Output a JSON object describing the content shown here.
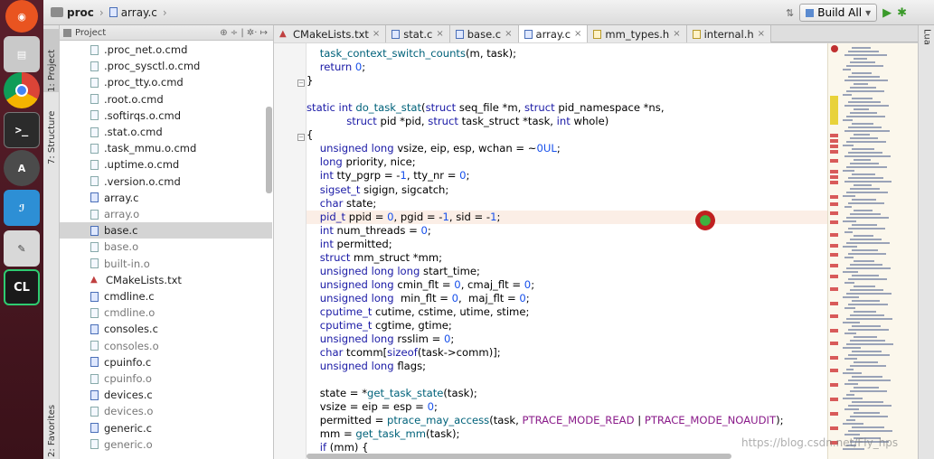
{
  "titlebar": {
    "crumb_folder": "proc",
    "crumb_file": "array.c",
    "build_config": "Build All",
    "build_arrow": "▾",
    "run_icon": "▶",
    "debug_icon": "✱",
    "swap_icon": "⇅"
  },
  "toolstrip": {
    "project": "1: Project",
    "structure": "7: Structure",
    "favorites": "2: Favorites",
    "lua": "Lua"
  },
  "project_panel": {
    "title": "Project",
    "tools": "⊕  ÷  |  ✲·  ↦",
    "items": [
      {
        "name": ".proc_net.o.cmd",
        "kind": "file",
        "dim": false
      },
      {
        "name": ".proc_sysctl.o.cmd",
        "kind": "file",
        "dim": false
      },
      {
        "name": ".proc_tty.o.cmd",
        "kind": "file",
        "dim": false
      },
      {
        "name": ".root.o.cmd",
        "kind": "file",
        "dim": false
      },
      {
        "name": ".softirqs.o.cmd",
        "kind": "file",
        "dim": false
      },
      {
        "name": ".stat.o.cmd",
        "kind": "file",
        "dim": false
      },
      {
        "name": ".task_mmu.o.cmd",
        "kind": "file",
        "dim": false
      },
      {
        "name": ".uptime.o.cmd",
        "kind": "file",
        "dim": false
      },
      {
        "name": ".version.o.cmd",
        "kind": "file",
        "dim": false
      },
      {
        "name": "array.c",
        "kind": "c",
        "dim": false
      },
      {
        "name": "array.o",
        "kind": "file",
        "dim": true
      },
      {
        "name": "base.c",
        "kind": "c",
        "dim": false
      },
      {
        "name": "base.o",
        "kind": "file",
        "dim": true
      },
      {
        "name": "built-in.o",
        "kind": "file",
        "dim": true
      },
      {
        "name": "CMakeLists.txt",
        "kind": "cmake",
        "dim": false
      },
      {
        "name": "cmdline.c",
        "kind": "c",
        "dim": false
      },
      {
        "name": "cmdline.o",
        "kind": "file",
        "dim": true
      },
      {
        "name": "consoles.c",
        "kind": "c",
        "dim": false
      },
      {
        "name": "consoles.o",
        "kind": "file",
        "dim": true
      },
      {
        "name": "cpuinfo.c",
        "kind": "c",
        "dim": false
      },
      {
        "name": "cpuinfo.o",
        "kind": "file",
        "dim": true
      },
      {
        "name": "devices.c",
        "kind": "c",
        "dim": false
      },
      {
        "name": "devices.o",
        "kind": "file",
        "dim": true
      },
      {
        "name": "generic.c",
        "kind": "c",
        "dim": false
      },
      {
        "name": "generic.o",
        "kind": "file",
        "dim": true
      }
    ]
  },
  "tabs": [
    {
      "label": "CMakeLists.txt",
      "kind": "cmake",
      "close": "×"
    },
    {
      "label": "stat.c",
      "kind": "c",
      "close": "×"
    },
    {
      "label": "base.c",
      "kind": "c",
      "close": "×"
    },
    {
      "label": "array.c",
      "kind": "c",
      "close": "×"
    },
    {
      "label": "mm_types.h",
      "kind": "h",
      "close": "×"
    },
    {
      "label": "internal.h",
      "kind": "h",
      "close": "×"
    }
  ],
  "code": [
    "    task_context_switch_counts(m, task);",
    "    return 0;",
    "}",
    "",
    "static int do_task_stat(struct seq_file *m, struct pid_namespace *ns,",
    "            struct pid *pid, struct task_struct *task, int whole)",
    "{",
    "    unsigned long vsize, eip, esp, wchan = ~0UL;",
    "    long priority, nice;",
    "    int tty_pgrp = -1, tty_nr = 0;",
    "    sigset_t sigign, sigcatch;",
    "    char state;",
    "    pid_t ppid = 0, pgid = -1, sid = -1;",
    "    int num_threads = 0;",
    "    int permitted;",
    "    struct mm_struct *mm;",
    "    unsigned long long start_time;",
    "    unsigned long cmin_flt = 0, cmaj_flt = 0;",
    "    unsigned long  min_flt = 0,  maj_flt = 0;",
    "    cputime_t cutime, cstime, utime, stime;",
    "    cputime_t cgtime, gtime;",
    "    unsigned long rsslim = 0;",
    "    char tcomm[sizeof(task->comm)];",
    "    unsigned long flags;",
    "",
    "    state = *get_task_state(task);",
    "    vsize = eip = esp = 0;",
    "    permitted = ptrace_may_access(task, PTRACE_MODE_READ | PTRACE_MODE_NOAUDIT);",
    "    mm = get_task_mm(task);",
    "    if (mm) {"
  ],
  "watermark": "https://blog.csdn.net/Fly_hps"
}
